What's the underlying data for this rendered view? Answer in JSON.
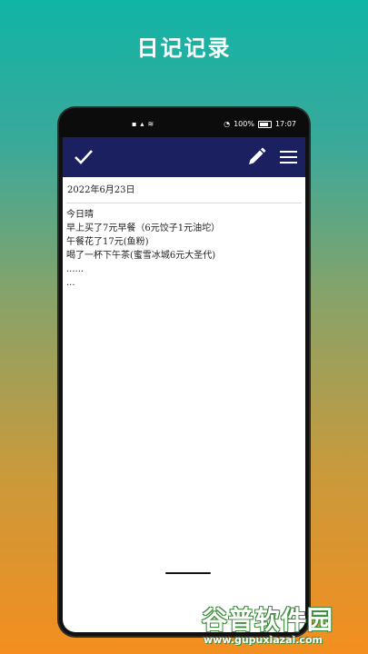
{
  "promo": {
    "title": "日记记录"
  },
  "statusbar": {
    "battery": "100%",
    "time": "17:07"
  },
  "entry": {
    "date": "2022年6月23日",
    "lines": [
      "今日晴",
      "早上买了7元早餐（6元饺子1元油坨）",
      "午餐花了17元(鱼粉)",
      "喝了一杯下午茶(蜜雪冰城6元大圣代)",
      "......",
      "..."
    ]
  },
  "watermark": {
    "logo": "谷普软件园",
    "url": "www.gupuxiazai.com"
  },
  "colors": {
    "appbar": "#1a2060",
    "gradient_top": "#10b4a6",
    "gradient_bottom": "#f48e1f"
  },
  "icons": {
    "confirm": "check-icon",
    "edit": "pencil-icon",
    "menu": "menu-icon"
  }
}
